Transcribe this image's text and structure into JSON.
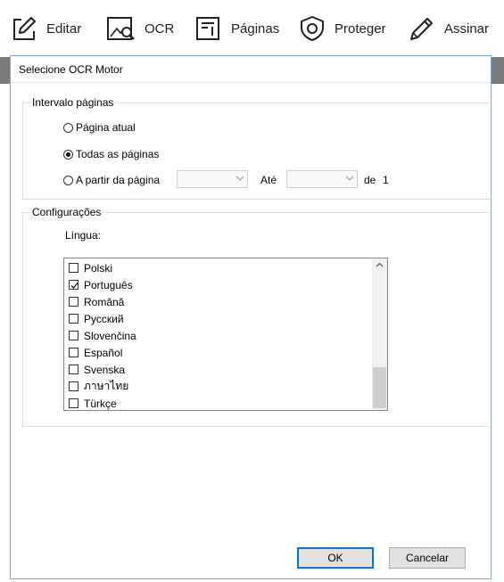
{
  "toolbar": {
    "items": [
      {
        "label": "Editar",
        "icon": "edit-icon"
      },
      {
        "label": "OCR",
        "icon": "ocr-icon"
      },
      {
        "label": "Páginas",
        "icon": "pages-icon"
      },
      {
        "label": "Proteger",
        "icon": "shield-icon"
      },
      {
        "label": "Assinar",
        "icon": "pen-icon"
      }
    ]
  },
  "dialog": {
    "title": "Selecione OCR Motor",
    "page_range": {
      "label": "Intervalo páginas",
      "options": [
        {
          "label": "Página atual",
          "selected": false
        },
        {
          "label": "Todas as páginas",
          "selected": true
        },
        {
          "label": "A partir da página",
          "selected": false
        }
      ],
      "from_value": "",
      "to_label": "Até",
      "to_value": "",
      "of_label": "de",
      "total_pages": "1"
    },
    "settings": {
      "label": "Configurações",
      "language_label": "Língua:",
      "languages": [
        {
          "label": "Polski",
          "checked": false
        },
        {
          "label": "Português",
          "checked": true
        },
        {
          "label": "Română",
          "checked": false
        },
        {
          "label": "Русский",
          "checked": false
        },
        {
          "label": "Slovenčina",
          "checked": false
        },
        {
          "label": "Español",
          "checked": false
        },
        {
          "label": "Svenska",
          "checked": false
        },
        {
          "label": "ภาษาไทย",
          "checked": false
        },
        {
          "label": "Türkçe",
          "checked": false
        }
      ]
    },
    "buttons": {
      "ok": "OK",
      "cancel": "Cancelar"
    }
  },
  "colors": {
    "dialog_border": "#7aa7d8",
    "primary_button_border": "#0078d7",
    "strip": "#7b7b7b"
  }
}
